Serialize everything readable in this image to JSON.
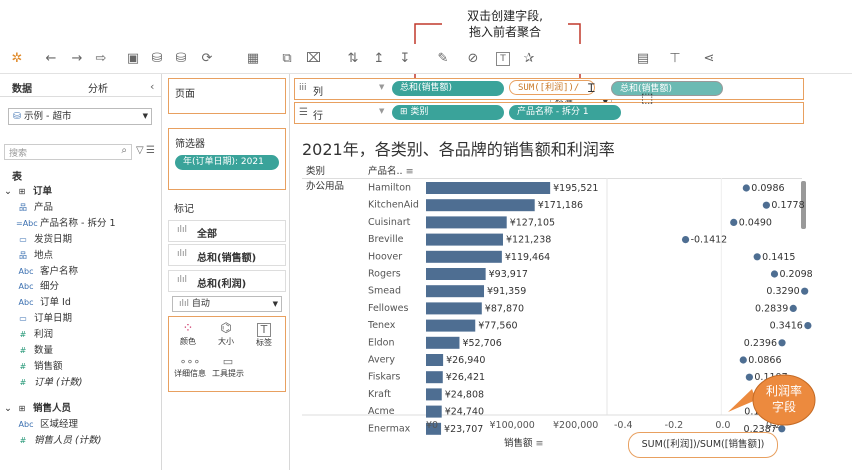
{
  "callout_top": {
    "line1": "双击创建字段,",
    "line2": "拖入前者聚合"
  },
  "callout_bubble": {
    "line1": "利润率",
    "line2": "字段"
  },
  "toolbar": {
    "standard": "标准"
  },
  "left": {
    "tab_data": "数据",
    "tab_analysis": "分析",
    "datasource": "示例 - 超市",
    "search_placeholder": "搜索",
    "table_header": "表",
    "fields": [
      {
        "icon": "⊞",
        "label": "订单",
        "kind": "table",
        "indent": 0,
        "bold": true
      },
      {
        "icon": "品",
        "label": "产品",
        "kind": "dim",
        "indent": 1
      },
      {
        "icon": "=Abc",
        "label": "产品名称 - 拆分 1",
        "kind": "dim",
        "indent": 1
      },
      {
        "icon": "▭",
        "label": "发货日期",
        "kind": "dim",
        "indent": 1
      },
      {
        "icon": "品",
        "label": "地点",
        "kind": "dim",
        "indent": 1
      },
      {
        "icon": "Abc",
        "label": "客户名称",
        "kind": "dim",
        "indent": 1
      },
      {
        "icon": "Abc",
        "label": "细分",
        "kind": "dim",
        "indent": 1
      },
      {
        "icon": "Abc",
        "label": "订单 Id",
        "kind": "dim",
        "indent": 1
      },
      {
        "icon": "▭",
        "label": "订单日期",
        "kind": "dim",
        "indent": 1
      },
      {
        "icon": "#",
        "label": "利润",
        "kind": "mea",
        "indent": 1
      },
      {
        "icon": "#",
        "label": "数量",
        "kind": "mea",
        "indent": 1
      },
      {
        "icon": "#",
        "label": "销售额",
        "kind": "mea",
        "indent": 1
      },
      {
        "icon": "#",
        "label": "订单 (计数)",
        "kind": "mea",
        "indent": 1,
        "italic": true
      },
      {
        "icon": "⊞",
        "label": "销售人员",
        "kind": "table",
        "indent": 0,
        "bold": true
      },
      {
        "icon": "Abc",
        "label": "区域经理",
        "kind": "dim",
        "indent": 1
      },
      {
        "icon": "#",
        "label": "销售人员 (计数)",
        "kind": "mea",
        "indent": 1,
        "italic": true
      }
    ]
  },
  "mid": {
    "pages": "页面",
    "filters": "筛选器",
    "filter_pill": "年(订单日期): 2021",
    "marks": "标记",
    "mark_all": "全部",
    "mark_sales": "总和(销售额)",
    "mark_profit": "总和(利润)",
    "mark_type": "自动",
    "buttons": [
      "颜色",
      "大小",
      "标签",
      "详细信息",
      "工具提示"
    ]
  },
  "shelves": {
    "columns_label": "列",
    "rows_label": "行",
    "col_pill_sales": "总和(销售额)",
    "col_pill_calc": "SUM([利润])/",
    "col_pill_drag": "总和(销售额)",
    "row_pill_category": "类别",
    "row_pill_product": "产品名称 - 拆分 1"
  },
  "chart_data": {
    "type": "bar",
    "title": "2021年，各类别、各品牌的销售额和利润率",
    "row_header_category": "类别",
    "row_header_product": "产品名..",
    "category": "办公用品",
    "categories": [
      "Hamilton",
      "KitchenAid",
      "Cuisinart",
      "Breville",
      "Hoover",
      "Rogers",
      "Smead",
      "Fellowes",
      "Tenex",
      "Eldon",
      "Avery",
      "Fiskars",
      "Kraft",
      "Acme",
      "Enermax"
    ],
    "series": [
      {
        "name": "销售额",
        "values": [
          195521,
          171186,
          127105,
          121238,
          119464,
          93917,
          91359,
          87870,
          77560,
          52706,
          26940,
          26421,
          24808,
          24740,
          23707
        ],
        "labels": [
          "¥195,521",
          "¥171,186",
          "¥127,105",
          "¥121,238",
          "¥119,464",
          "¥93,917",
          "¥91,359",
          "¥87,870",
          "¥77,560",
          "¥52,706",
          "¥26,940",
          "¥26,421",
          "¥24,808",
          "¥24,740",
          "¥23,707"
        ]
      },
      {
        "name": "SUM([利润])/SUM([销售额])",
        "values": [
          0.0986,
          0.1778,
          0.049,
          -0.1412,
          0.1415,
          0.2098,
          0.329,
          0.2839,
          0.3416,
          0.2396,
          0.0866,
          0.1107,
          0.1967,
          0.17,
          0.2387
        ],
        "labels": [
          "0.0986",
          "0.1778",
          "0.0490",
          "-0.1412",
          "0.1415",
          "0.2098",
          "0.3290",
          "0.2839",
          "0.3416",
          "0.2396",
          "0.0866",
          "0.1107",
          "0.1967",
          "0.1",
          "0.2387"
        ]
      }
    ],
    "x1_ticks": [
      "¥0",
      "¥100,000",
      "¥200,000"
    ],
    "x1_tick_values": [
      0,
      100000,
      200000
    ],
    "x1_label": "销售额",
    "x2_ticks": [
      "-0.4",
      "-0.2",
      "0.0",
      "0.2"
    ],
    "x2_tick_values": [
      -0.4,
      -0.2,
      0.0,
      0.2
    ],
    "x2_label": "SUM([利润])/SUM([销售额])",
    "bar_color": "#4e6e92",
    "dot_color": "#4e6e92"
  },
  "colors": {
    "accent_orange": "#e8a060",
    "pill_green": "#3aa39a",
    "callout_red": "#c0392b",
    "bubble": "#ec8a3e"
  }
}
